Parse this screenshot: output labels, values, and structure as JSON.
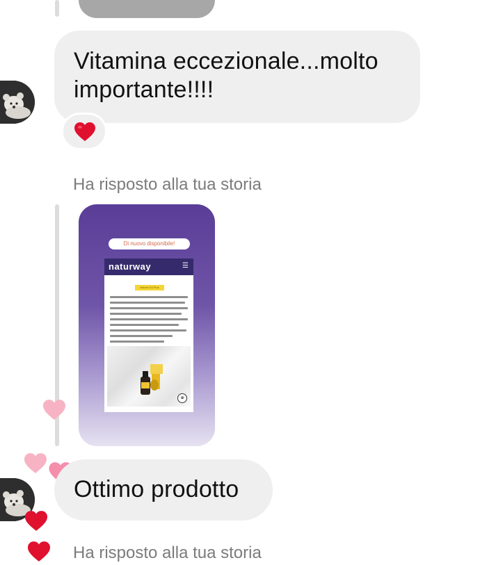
{
  "messages": [
    {
      "text": "Vitamina eccezionale...molto importante!!!!",
      "reaction": "❤️"
    },
    {
      "text": "Ottimo prodotto"
    }
  ],
  "story_replies": [
    {
      "label": "Ha risposto alla tua storia"
    },
    {
      "label": "Ha risposto alla tua storia"
    }
  ],
  "story_preview": {
    "banner": "Di nuovo disponibile!",
    "logo": "naturway",
    "menu_icon": "hamburger-icon",
    "tag": "Nature D3 Plus"
  },
  "colors": {
    "bubble": "#efefef",
    "heart_red": "#e0102f",
    "heart_pink": "#f48eab",
    "heart_light_pink": "#f7b3c4",
    "story_purple": "#5a3d97",
    "meta_text": "#7b7b7b"
  }
}
